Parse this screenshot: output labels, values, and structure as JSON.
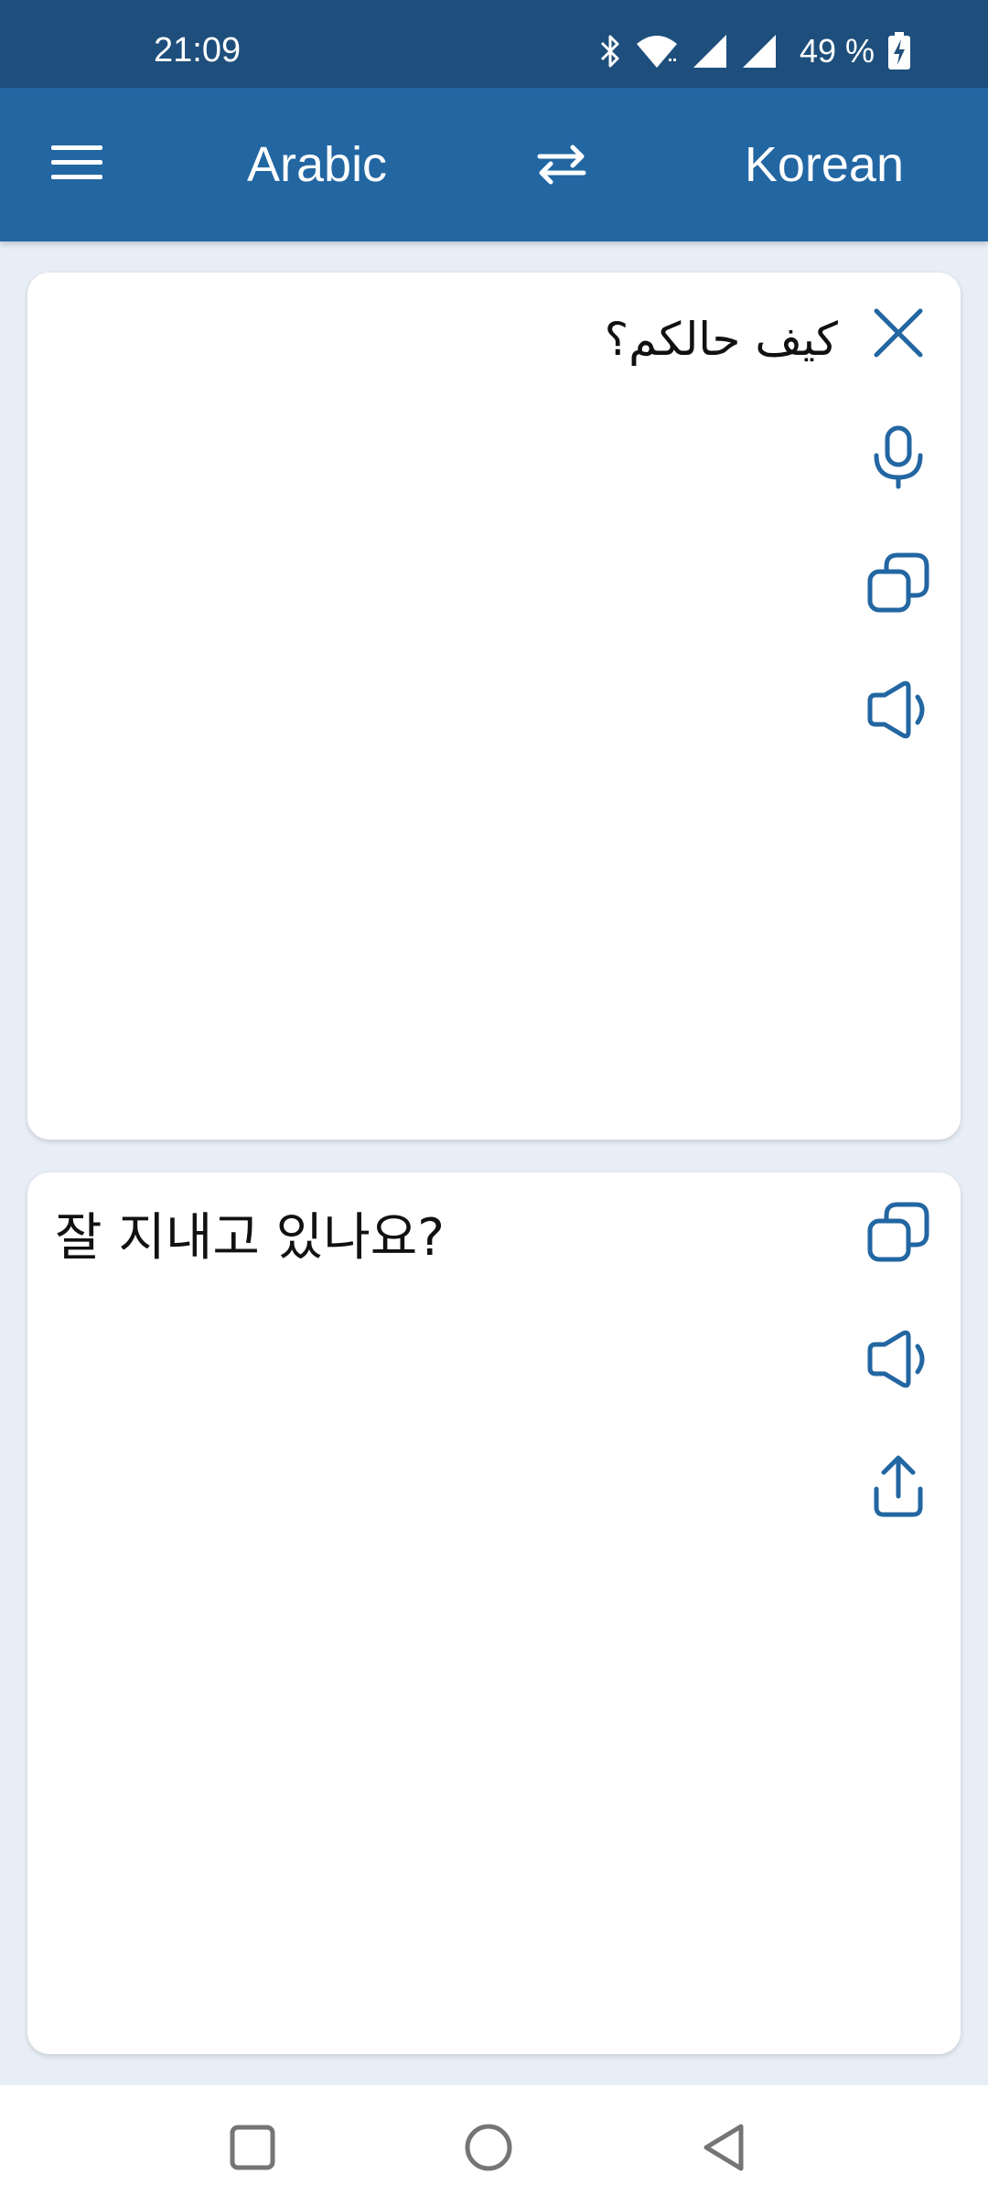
{
  "status_bar": {
    "time": "21:09",
    "battery": "49 %",
    "icons": [
      "bluetooth-icon",
      "wifi-icon",
      "signal-icon",
      "signal-icon",
      "battery-charging-icon"
    ]
  },
  "app_bar": {
    "source_language": "Arabic",
    "target_language": "Korean",
    "icons": [
      "menu-icon",
      "swap-icon"
    ]
  },
  "input_card": {
    "text": "كيف حالكم؟",
    "icons": [
      "close-icon",
      "microphone-icon",
      "copy-icon",
      "speaker-icon"
    ]
  },
  "output_card": {
    "text": "잘 지내고 있나요?",
    "icons": [
      "copy-icon",
      "speaker-icon",
      "share-icon"
    ]
  },
  "nav_bar": {
    "icons": [
      "recents-icon",
      "home-icon",
      "back-icon"
    ]
  },
  "colors": {
    "status_bar": "#1e4f7c",
    "app_bar": "#2266a2",
    "background": "#e8eef6",
    "icon_blue": "#2266a2"
  }
}
